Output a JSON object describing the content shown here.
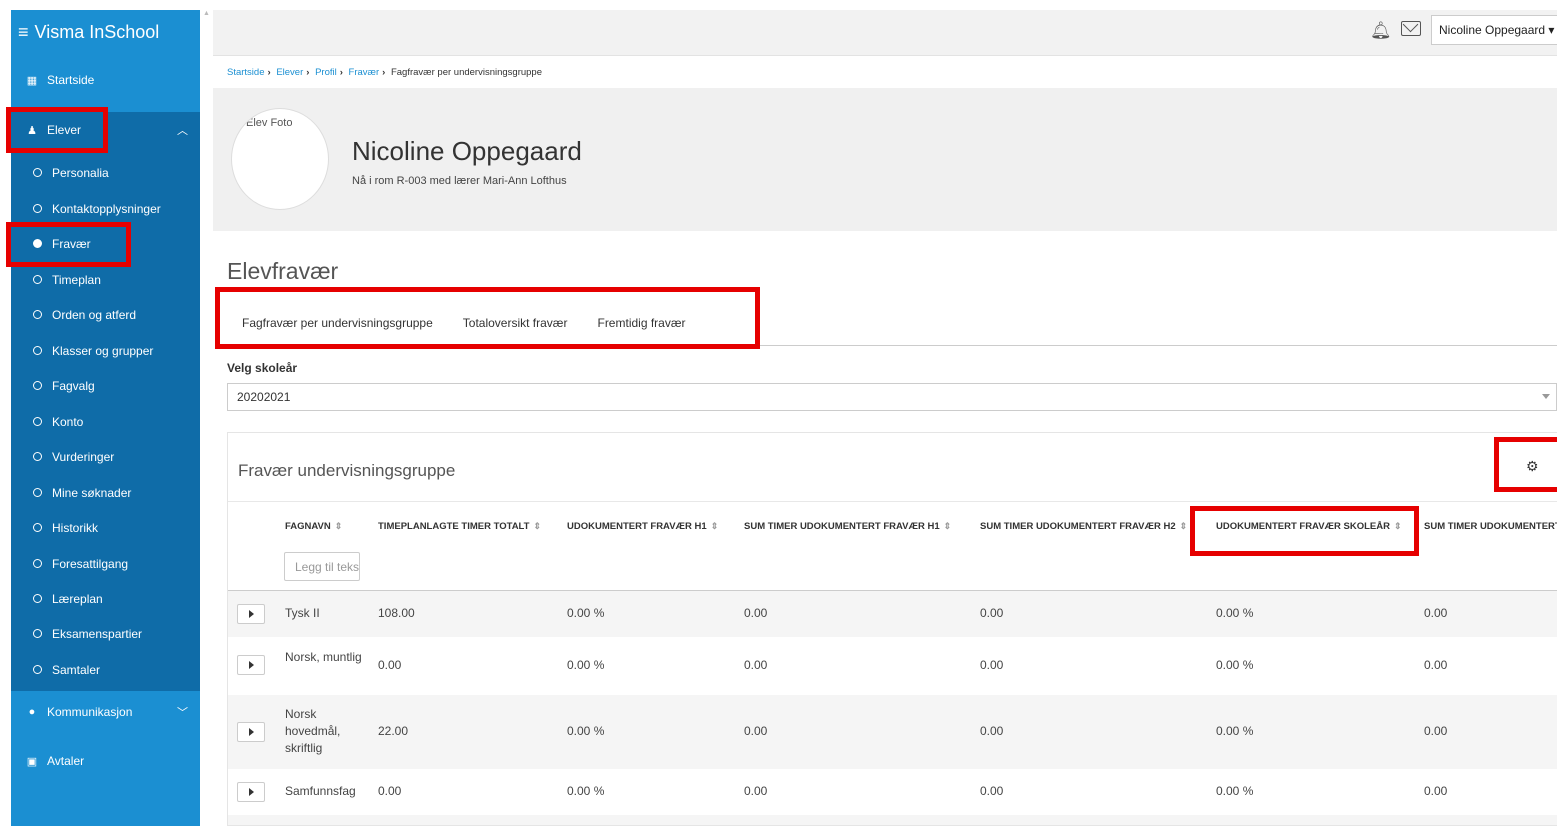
{
  "app": {
    "title": "Visma InSchool"
  },
  "sidebar": {
    "items": [
      {
        "label": "Startside",
        "icon": "grid-icon"
      },
      {
        "label": "Elever",
        "icon": "student-icon"
      },
      {
        "label": "Kommunikasjon",
        "icon": "chat-icon"
      },
      {
        "label": "Avtaler",
        "icon": "calendar-icon"
      }
    ],
    "sub_items": [
      {
        "label": "Personalia"
      },
      {
        "label": "Kontaktopplysninger"
      },
      {
        "label": "Fravær"
      },
      {
        "label": "Timeplan"
      },
      {
        "label": "Orden og atferd"
      },
      {
        "label": "Klasser og grupper"
      },
      {
        "label": "Fagvalg"
      },
      {
        "label": "Konto"
      },
      {
        "label": "Vurderinger"
      },
      {
        "label": "Mine søknader"
      },
      {
        "label": "Historikk"
      },
      {
        "label": "Foresattilgang"
      },
      {
        "label": "Læreplan"
      },
      {
        "label": "Eksamenspartier"
      },
      {
        "label": "Samtaler"
      }
    ]
  },
  "topbar": {
    "user": "Nicoline Oppegaard"
  },
  "breadcrumb": {
    "items": [
      "Startside",
      "Elever",
      "Profil",
      "Fravær"
    ],
    "current": "Fagfravær per undervisningsgruppe"
  },
  "profile": {
    "photo_alt": "Elev Foto",
    "name": "Nicoline Oppegaard",
    "subtitle": "Nå i rom R-003 med lærer Mari-Ann Lofthus"
  },
  "page": {
    "title": "Elevfravær"
  },
  "tabs": [
    {
      "label": "Fagfravær per undervisningsgruppe"
    },
    {
      "label": "Totaloversikt fravær"
    },
    {
      "label": "Fremtidig fravær"
    }
  ],
  "school_year": {
    "label": "Velg skoleår",
    "value": "20202021"
  },
  "table": {
    "title": "Fravær undervisningsgruppe",
    "filter_placeholder": "Legg til tekst",
    "columns": [
      "FAGNAVN",
      "TIMEPLANLAGTE TIMER TOTALT",
      "UDOKUMENTERT FRAVÆR H1",
      "SUM TIMER UDOKUMENTERT FRAVÆR H1",
      "SUM TIMER UDOKUMENTERT FRAVÆR H2",
      "UDOKUMENTERT FRAVÆR SKOLEÅR",
      "SUM TIMER UDOKUMENTERT"
    ],
    "rows": [
      {
        "name": "Tysk II",
        "c1": "108.00",
        "c2": "0.00 %",
        "c3": "0.00",
        "c4": "0.00",
        "c5": "0.00 %",
        "c6": "0.00"
      },
      {
        "name": "Norsk, muntlig",
        "c1": "0.00",
        "c2": "0.00 %",
        "c3": "0.00",
        "c4": "0.00",
        "c5": "0.00 %",
        "c6": "0.00"
      },
      {
        "name": "Norsk hovedmål, skriftlig",
        "c1": "22.00",
        "c2": "0.00 %",
        "c3": "0.00",
        "c4": "0.00",
        "c5": "0.00 %",
        "c6": "0.00"
      },
      {
        "name": "Samfunnsfag",
        "c1": "0.00",
        "c2": "0.00 %",
        "c3": "0.00",
        "c4": "0.00",
        "c5": "0.00 %",
        "c6": "0.00"
      }
    ]
  },
  "colors": {
    "sidebar": "#1b8fd2",
    "sidebar_sub": "#0f6ca8",
    "highlight": "#e60000"
  }
}
